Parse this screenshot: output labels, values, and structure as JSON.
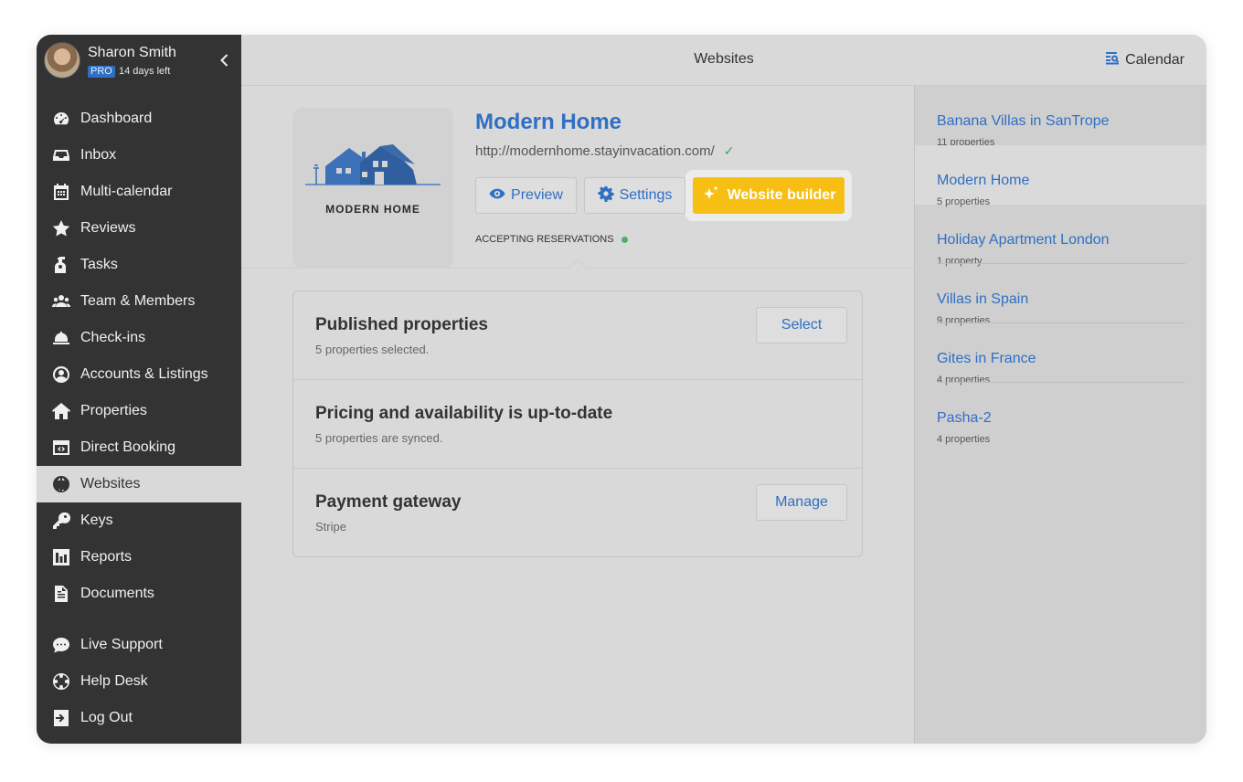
{
  "user": {
    "name": "Sharon Smith",
    "badge": "PRO",
    "trial": "14 days left"
  },
  "nav": {
    "items": [
      {
        "label": "Dashboard",
        "icon": "dashboard-icon"
      },
      {
        "label": "Inbox",
        "icon": "inbox-icon"
      },
      {
        "label": "Multi-calendar",
        "icon": "calendar-grid-icon"
      },
      {
        "label": "Reviews",
        "icon": "star-icon"
      },
      {
        "label": "Tasks",
        "icon": "tasks-icon"
      },
      {
        "label": "Team & Members",
        "icon": "users-icon"
      },
      {
        "label": "Check-ins",
        "icon": "bell-icon"
      },
      {
        "label": "Accounts & Listings",
        "icon": "user-circle-icon"
      },
      {
        "label": "Properties",
        "icon": "home-icon"
      },
      {
        "label": "Direct Booking",
        "icon": "code-window-icon"
      },
      {
        "label": "Websites",
        "icon": "globe-icon",
        "active": true
      },
      {
        "label": "Keys",
        "icon": "key-icon"
      },
      {
        "label": "Reports",
        "icon": "bar-chart-icon"
      },
      {
        "label": "Documents",
        "icon": "document-icon"
      }
    ],
    "bottom": [
      {
        "label": "Live Support",
        "icon": "chat-icon"
      },
      {
        "label": "Help Desk",
        "icon": "lifebuoy-icon"
      },
      {
        "label": "Log Out",
        "icon": "logout-icon"
      }
    ]
  },
  "topbar": {
    "title": "Websites",
    "calendar_label": "Calendar"
  },
  "site": {
    "title": "Modern Home",
    "url": "http://modernhome.stayinvacation.com/",
    "logo_text": "MODERN HOME",
    "preview_label": "Preview",
    "settings_label": "Settings",
    "builder_label": "Website builder",
    "status": "ACCEPTING RESERVATIONS"
  },
  "panel": {
    "rows": [
      {
        "title": "Published properties",
        "sub": "5 properties selected.",
        "button": "Select"
      },
      {
        "title": "Pricing and availability is up-to-date",
        "sub": "5 properties are synced.",
        "button": ""
      },
      {
        "title": "Payment gateway",
        "sub": "Stripe",
        "button": "Manage"
      }
    ]
  },
  "sites": [
    {
      "name": "Banana Villas in SanTrope",
      "count": "11 properties"
    },
    {
      "name": "Modern Home",
      "count": "5 properties",
      "active": true
    },
    {
      "name": "Holiday Apartment London",
      "count": "1 property"
    },
    {
      "name": "Villas in Spain",
      "count": "9 properties"
    },
    {
      "name": "Gites in France",
      "count": "4 properties"
    },
    {
      "name": "Pasha-2",
      "count": "4 properties"
    }
  ],
  "colors": {
    "accent": "#2f6fc4",
    "builder": "#f7be13",
    "sidebar": "#333333",
    "status_ok": "#4caf6a"
  }
}
